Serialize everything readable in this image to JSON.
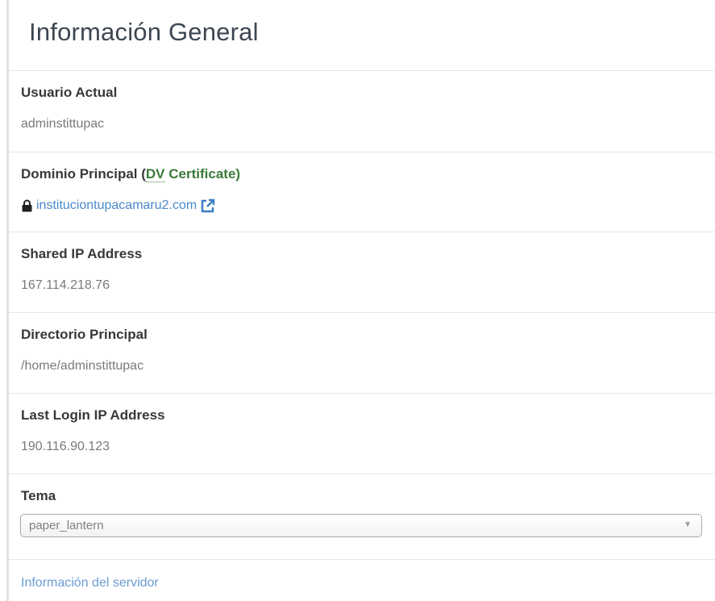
{
  "panel": {
    "title": "Información General"
  },
  "current_user": {
    "label": "Usuario Actual",
    "value": "adminstittupac"
  },
  "primary_domain": {
    "label_prefix": "Dominio Principal (",
    "cert_abbr": "DV",
    "cert_suffix": " Certificate)",
    "domain": "instituciontupacamaru2.com",
    "lock_icon": "lock-icon",
    "external_icon": "external-link-icon"
  },
  "shared_ip": {
    "label": "Shared IP Address",
    "value": "167.114.218.76"
  },
  "home_directory": {
    "label": "Directorio Principal",
    "value": "/home/adminstittupac"
  },
  "last_login_ip": {
    "label": "Last Login IP Address",
    "value": "190.116.90.123"
  },
  "theme": {
    "label": "Tema",
    "selected": "paper_lantern",
    "arrow": "▼"
  },
  "server_info": {
    "link": "Información del servidor"
  },
  "colors": {
    "link": "#4a89c9",
    "certificate": "#3a7a3a",
    "label": "#383838",
    "value": "#7a7a7a"
  }
}
